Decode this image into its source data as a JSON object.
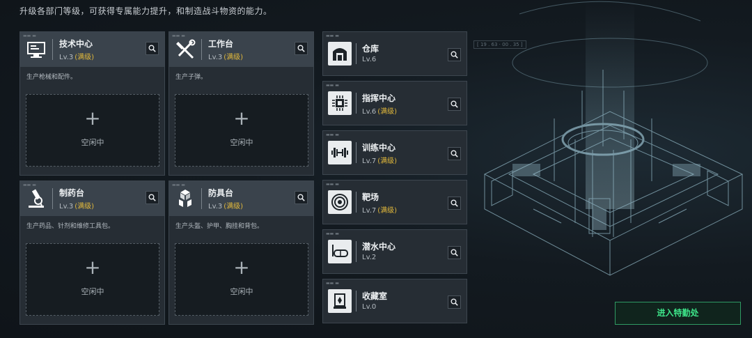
{
  "subtitle": "升级各部门等级，可获得专属能力提升，和制造战斗物资的能力。",
  "coord_readout": "[ 19 . 63 · 00 . 35 ]",
  "colors": {
    "accent_max": "#e2b93b",
    "enter_green": "#3ee58a"
  },
  "big_cards": [
    {
      "name": "技术中心",
      "level": "Lv.3",
      "max": "(满级)",
      "desc": "生产枪械和配件。",
      "slot_plus": "+",
      "slot_status": "空闲中",
      "icon": "computer-icon"
    },
    {
      "name": "工作台",
      "level": "Lv.3",
      "max": "(满级)",
      "desc": "生产子弹。",
      "slot_plus": "+",
      "slot_status": "空闲中",
      "icon": "tools-icon"
    },
    {
      "name": "制药台",
      "level": "Lv.3",
      "max": "(满级)",
      "desc": "生产药品、针剂和维修工具包。",
      "slot_plus": "+",
      "slot_status": "空闲中",
      "icon": "microscope-icon"
    },
    {
      "name": "防具台",
      "level": "Lv.3",
      "max": "(满级)",
      "desc": "生产头盔、护甲、胸挂和背包。",
      "slot_plus": "+",
      "slot_status": "空闲中",
      "icon": "boxes-icon"
    }
  ],
  "small_cards": [
    {
      "name": "仓库",
      "level": "Lv.6",
      "max": "",
      "icon": "warehouse-icon"
    },
    {
      "name": "指挥中心",
      "level": "Lv.6",
      "max": "(满级)",
      "icon": "chip-icon"
    },
    {
      "name": "训练中心",
      "level": "Lv.7",
      "max": "(满级)",
      "icon": "dumbbell-icon"
    },
    {
      "name": "靶场",
      "level": "Lv.7",
      "max": "(满级)",
      "icon": "target-icon"
    },
    {
      "name": "潜水中心",
      "level": "Lv.2",
      "max": "",
      "icon": "diving-mask-icon"
    },
    {
      "name": "收藏室",
      "level": "Lv.0",
      "max": "",
      "icon": "display-case-icon"
    }
  ],
  "enter_button": "进入特勤处"
}
